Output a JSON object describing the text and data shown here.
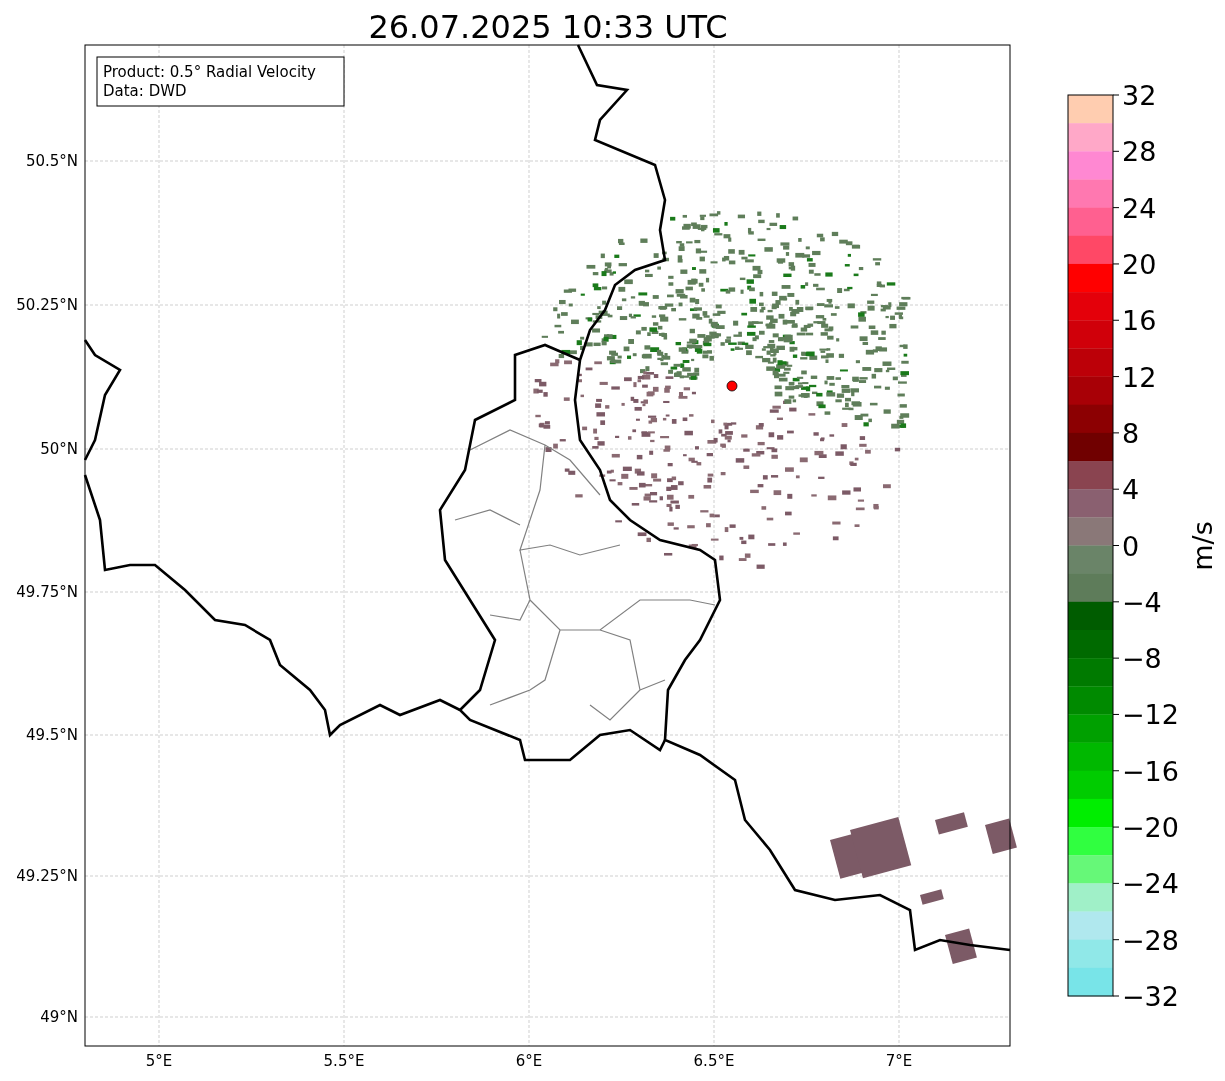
{
  "title": "26.07.2025 10:33 UTC",
  "info_box": [
    "Product: 0.5° Radial Velocity",
    "Data: DWD"
  ],
  "lat_ticks": [
    "50.5°N",
    "50.25°N",
    "50°N",
    "49.75°N",
    "49.5°N",
    "49.25°N",
    "49°N"
  ],
  "lon_ticks": [
    "5°E",
    "5.5°E",
    "6°E",
    "6.5°E",
    "7°E"
  ],
  "colorbar": {
    "label": "m/s",
    "ticks": [
      "32",
      "28",
      "24",
      "20",
      "16",
      "12",
      "8",
      "4",
      "0",
      "−4",
      "−8",
      "−12",
      "−16",
      "−20",
      "−24",
      "−28",
      "−32"
    ],
    "segments": [
      {
        "color": "#ffcdb0"
      },
      {
        "color": "#ffa8c8"
      },
      {
        "color": "#ff88d2"
      },
      {
        "color": "#ff78b0"
      },
      {
        "color": "#ff6090"
      },
      {
        "color": "#ff4866"
      },
      {
        "color": "#ff0000"
      },
      {
        "color": "#e4000a"
      },
      {
        "color": "#d0000a"
      },
      {
        "color": "#bc0008"
      },
      {
        "color": "#a80006"
      },
      {
        "color": "#8c0002"
      },
      {
        "color": "#700000"
      },
      {
        "color": "#8a4450"
      },
      {
        "color": "#8a6070"
      },
      {
        "color": "#8a7878"
      },
      {
        "color": "#6a8468"
      },
      {
        "color": "#5e7c5a"
      },
      {
        "color": "#005c00"
      },
      {
        "color": "#006a00"
      },
      {
        "color": "#007a00"
      },
      {
        "color": "#008a00"
      },
      {
        "color": "#00a000"
      },
      {
        "color": "#00b800"
      },
      {
        "color": "#00cc00"
      },
      {
        "color": "#00ee00"
      },
      {
        "color": "#30ff40"
      },
      {
        "color": "#66f878"
      },
      {
        "color": "#a0f0c8"
      },
      {
        "color": "#b0e8ee"
      },
      {
        "color": "#90e8e8"
      },
      {
        "color": "#78e4e8"
      }
    ]
  }
}
